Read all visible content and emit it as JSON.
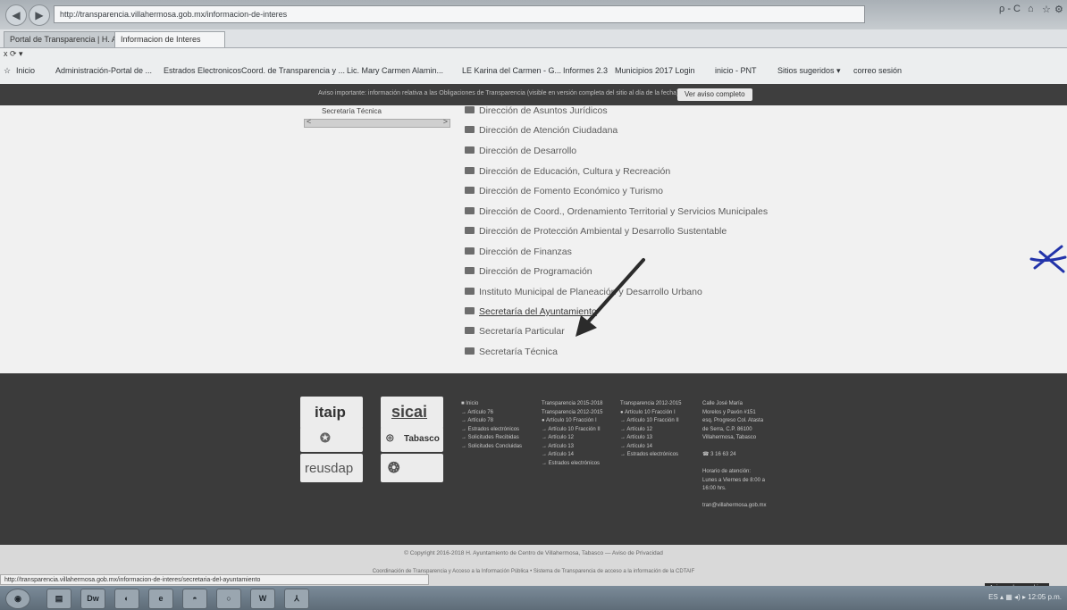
{
  "browser": {
    "address": "http://transparencia.villahermosa.gob.mx/informacion-de-interes",
    "search_hint": "ρ - C",
    "tabs": [
      "Portal de Transparencia | H. Ay...",
      "Informacion de Interes"
    ],
    "menu": "x ⟳ ▾",
    "favorites": [
      "Inicio",
      "Administración-Portal de ...",
      "Estrados Electronicos",
      "Coord. de Transparencia y ...",
      "Lic. Mary Carmen Alamin...",
      "LE Karina del Carmen - G...",
      "Informes 2.3",
      "Municipios 2017 Login",
      "inicio - PNT",
      "Sitios sugeridos ▾",
      "correo sesión"
    ]
  },
  "notice": {
    "text": "Aviso importante: información relativa a las Obligaciones de Transparencia (visible en versión completa del sitio al día de la fecha)",
    "button": "Ver aviso completo"
  },
  "tree": {
    "label": "Secretaría Técnica",
    "left": "<",
    "right": ">"
  },
  "list": [
    "Dirección de Asuntos Jurídicos",
    "Dirección de Atención Ciudadana",
    "Dirección de Desarrollo",
    "Dirección de Educación, Cultura y Recreación",
    "Dirección de Fomento Económico y Turismo",
    "Dirección de Coord., Ordenamiento Territorial y Servicios Municipales",
    "Dirección de Protección Ambiental y Desarrollo Sustentable",
    "Dirección de Finanzas",
    "Dirección de Programación",
    "Instituto Municipal de Planeación y Desarrollo Urbano",
    "Secretaría del Ayuntamiento",
    "Secretaría Particular",
    "Secretaría Técnica"
  ],
  "footer": {
    "logos": [
      "itaip",
      "sicai",
      "Tabasco",
      "reusdap"
    ],
    "col1": [
      "■ Inicio",
      "→ Artículo 76",
      "→ Artículo 78",
      "→ Estrados electrónicos",
      "→ Solicitudes Recibidas",
      "→ Solicitudes Concluidas"
    ],
    "col2": [
      "Transparencia 2015-2018",
      "Transparencia 2012-2015",
      "● Artículo 10 Fracción I",
      "→ Artículo 10 Fracción II",
      "→ Artículo 12",
      "→ Artículo 13",
      "→ Artículo 14",
      "→ Estrados electrónicos"
    ],
    "col3": [
      "Transparencia 2012-2015",
      "● Artículo 10 Fracción I",
      "→ Artículo 10 Fracción II",
      "→ Artículo 12",
      "→ Artículo 13",
      "→ Artículo 14",
      "→ Estrados electrónicos"
    ],
    "contact": [
      "Calle José María",
      "Morelos y Pavón #151",
      "esq. Progreso Col. Atasta",
      "de Serra, C.P. 86100",
      "Villahermosa, Tabasco",
      "",
      "☎ 3 16 63 24",
      "",
      "Horario de atención:",
      "Lunes a Viernes de 8:00 a",
      "16:00 hrs.",
      "",
      "tran@villahermosa.gob.mx"
    ]
  },
  "copyright": "© Copyright 2016-2018 H. Ayuntamiento de Centro de Villahermosa, Tabasco — Aviso de Privacidad",
  "pnt": "Coordinación de Transparencia y Acceso a la Información Pública • Sistema de Transparencia de acceso a la información de la CDTAIF",
  "status_url": "http://transparencia.villahermosa.gob.mx/informacion-de-interes/secretaria-del-ayuntamiento",
  "aviso": "Aviso sobre cookies",
  "taskbar": {
    "icons": [
      "◉",
      "▤",
      "Dw",
      "◐",
      "e",
      "◓",
      "○",
      "W",
      "⅄"
    ],
    "tray": "ES ▴ ▦ ◂) ▸ 12:05 p.m."
  }
}
